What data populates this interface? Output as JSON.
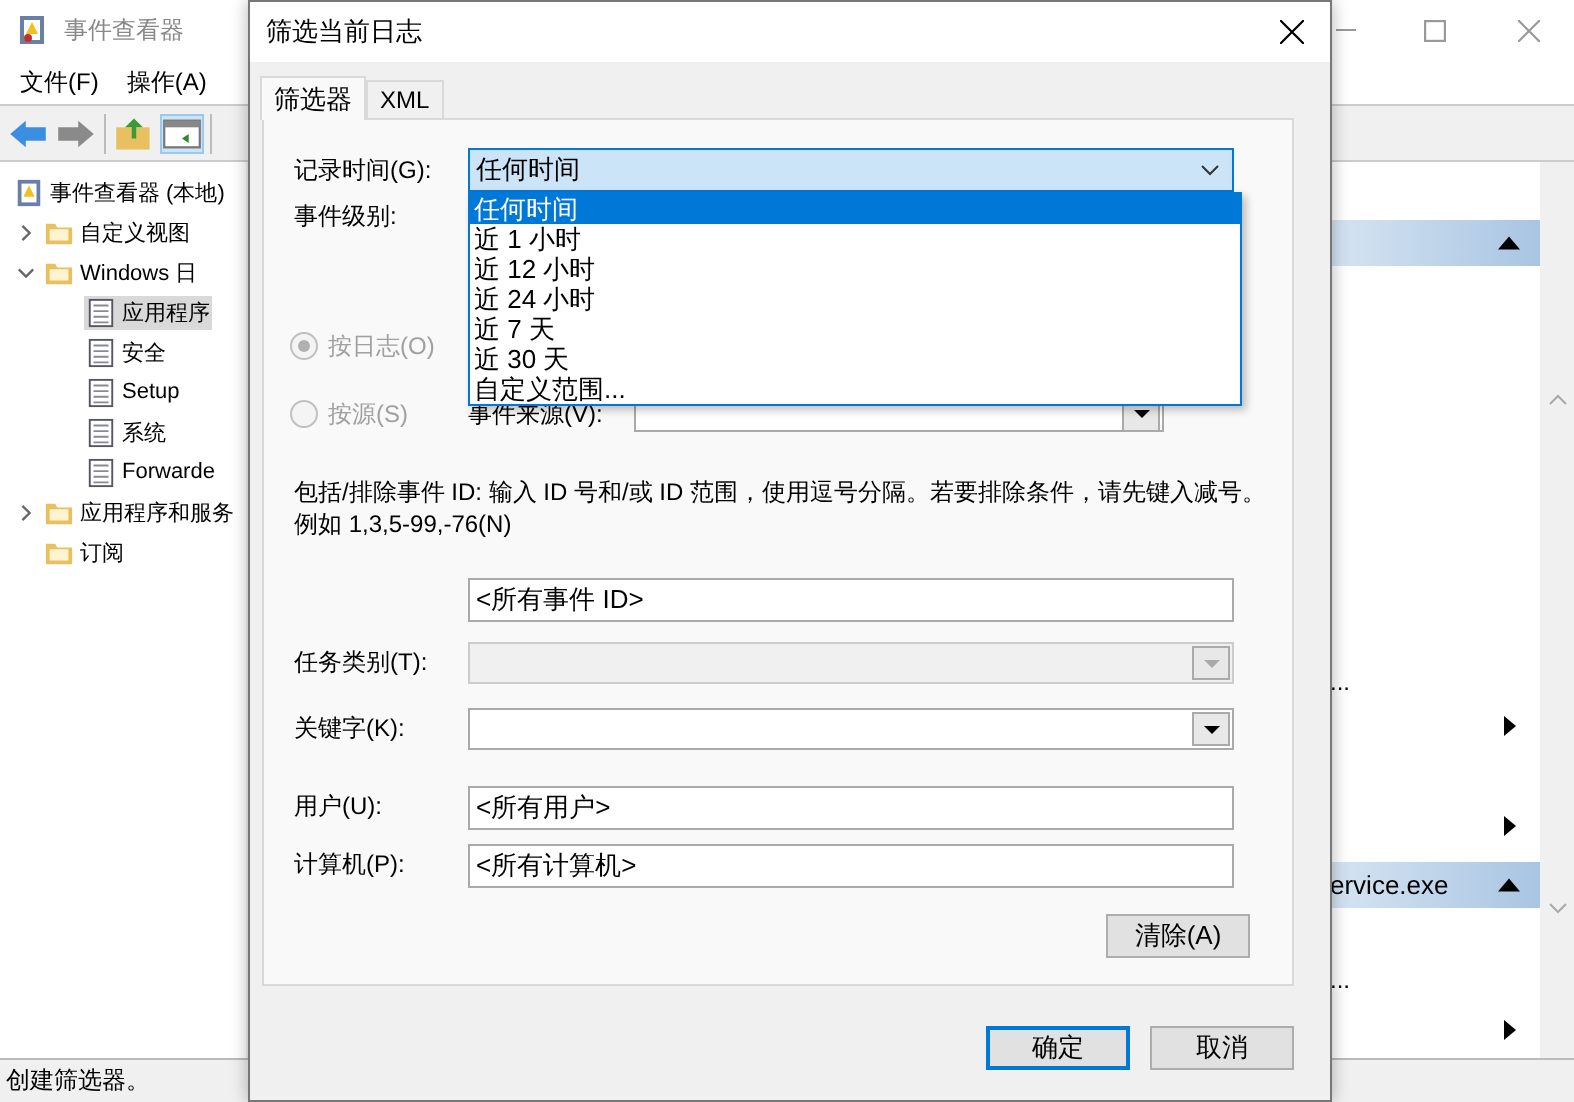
{
  "main_window": {
    "title": "事件查看器",
    "menu": [
      "文件(F)",
      "操作(A)"
    ],
    "tree": [
      {
        "label": "事件查看器 (本地)",
        "selected": false,
        "children": [
          {
            "label": "自定义视图",
            "selected": false,
            "expanded": false
          },
          {
            "label": "Windows 日",
            "selected": false,
            "expanded": true,
            "children": [
              {
                "label": "应用程序",
                "selected": true
              },
              {
                "label": "安全",
                "selected": false
              },
              {
                "label": "Setup",
                "selected": false
              },
              {
                "label": "系统",
                "selected": false
              },
              {
                "label": "Forwarde",
                "selected": false
              }
            ]
          },
          {
            "label": "应用程序和服务",
            "selected": false,
            "expanded": false
          },
          {
            "label": "订阅",
            "selected": false
          }
        ]
      }
    ],
    "actions": [
      {
        "kind": "header"
      },
      {
        "kind": "item",
        "label": "...",
        "submenu": false
      },
      {
        "kind": "item",
        "submenu": true
      },
      {
        "kind": "item",
        "submenu": true
      },
      {
        "kind": "header",
        "label": "ervice.exe"
      },
      {
        "kind": "item",
        "label": "...",
        "submenu": false
      },
      {
        "kind": "item",
        "submenu": true
      }
    ],
    "status_bar": "创建筛选器。"
  },
  "dialog": {
    "title": "筛选当前日志",
    "tabs": [
      {
        "label": "筛选器",
        "selected": true
      },
      {
        "label": "XML",
        "selected": false
      }
    ],
    "logged": {
      "label": "记录时间(G):",
      "value": "任何时间",
      "options": [
        {
          "label": "任何时间",
          "selected": true
        },
        {
          "label": "近 1 小时",
          "selected": false
        },
        {
          "label": "近 12 小时",
          "selected": false
        },
        {
          "label": "近 24 小时",
          "selected": false
        },
        {
          "label": "近 7 天",
          "selected": false
        },
        {
          "label": "近 30 天",
          "selected": false
        },
        {
          "label": "自定义范围...",
          "selected": false
        }
      ]
    },
    "event_level": {
      "label": "事件级别:"
    },
    "scope": [
      {
        "label": "按日志(O)",
        "selected": true,
        "disabled": true
      },
      {
        "label": "按源(S)",
        "selected": false,
        "disabled": true
      }
    ],
    "event_source": {
      "label": "事件来源(V):"
    },
    "id_hint": "包括/排除事件 ID: 输入 ID 号和/或 ID 范围，使用逗号分隔。若要排除条件，请先键入减号。例如 1,3,5-99,-76(N)",
    "event_id": {
      "value": "<所有事件 ID>"
    },
    "task_category": {
      "label": "任务类别(T):",
      "disabled": true
    },
    "keywords": {
      "label": "关键字(K):"
    },
    "user": {
      "label": "用户(U):",
      "value": "<所有用户>"
    },
    "computer": {
      "label": "计算机(P):",
      "value": "<所有计算机>"
    },
    "clear_button": "清除(A)",
    "buttons": [
      {
        "label": "确定",
        "default": true
      },
      {
        "label": "取消",
        "default": false
      }
    ]
  }
}
